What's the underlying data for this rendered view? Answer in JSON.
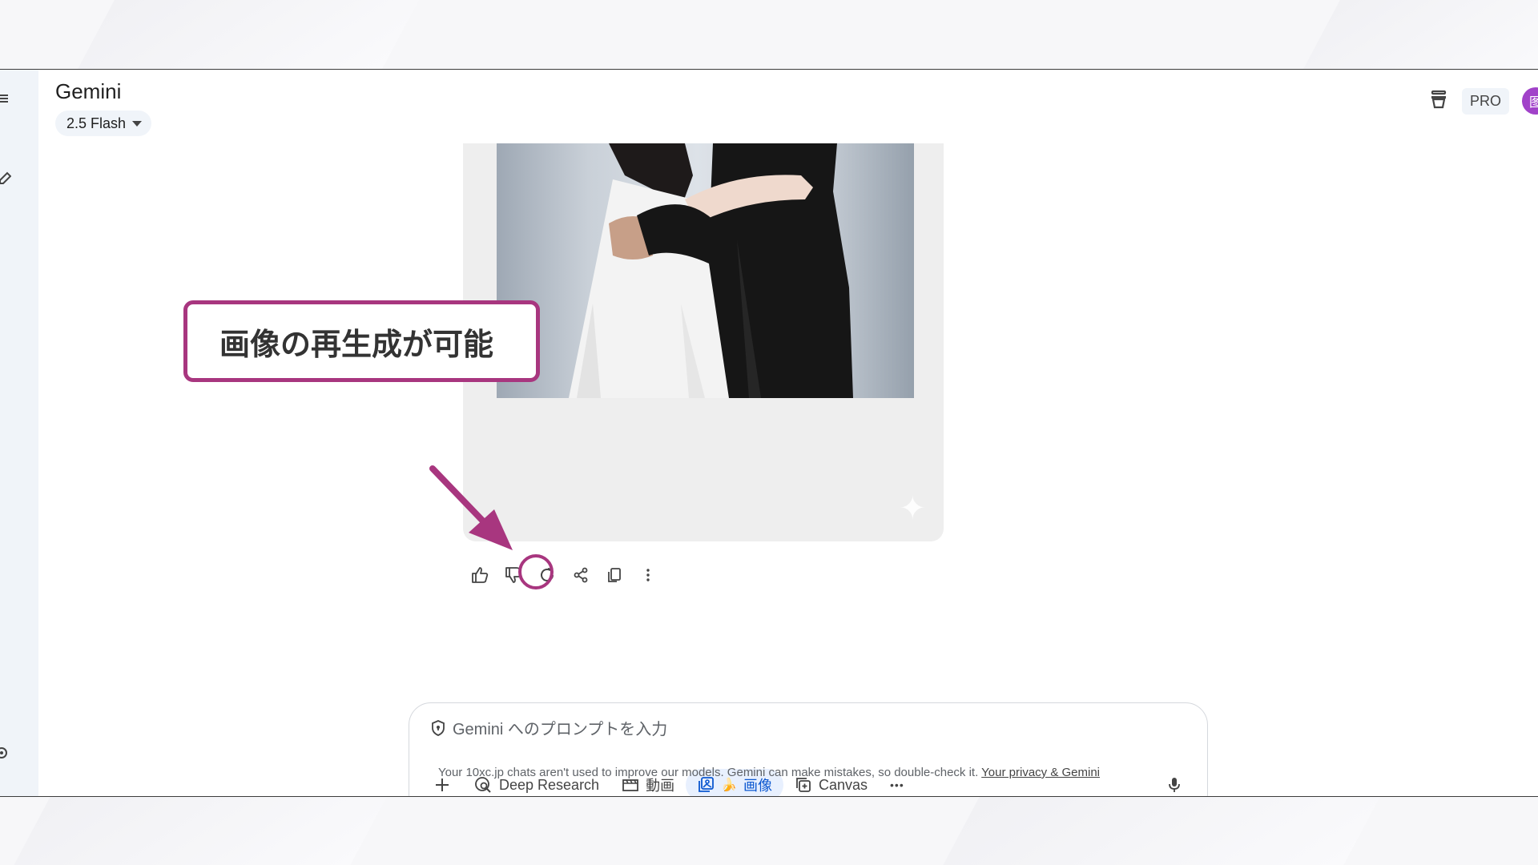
{
  "app": {
    "title": "Gemini",
    "model_label": "2.5 Flash",
    "pro_label": "PRO",
    "avatar_initial": "图"
  },
  "callout": {
    "text": "画像の再生成が可能",
    "color": "#a8367f"
  },
  "actions": [
    "thumbs-up-icon",
    "thumbs-down-icon",
    "regenerate-icon",
    "share-icon",
    "copy-icon",
    "more-vert-icon"
  ],
  "prompt": {
    "placeholder": "Gemini へのプロンプトを入力"
  },
  "tools": {
    "deep_research": "Deep Research",
    "video": "動画",
    "image_emoji": "🍌",
    "image": "画像",
    "canvas": "Canvas",
    "more": "•••"
  },
  "footer": {
    "text": "Your 10xc.jp chats aren't used to improve our models. Gemini can make mistakes, so double-check it. ",
    "link": "Your privacy & Gemini"
  },
  "colors": {
    "accent_blue": "#0b57d0",
    "active_tool_bg": "#e8f0fe",
    "sidebar_bg": "#f0f4f9"
  }
}
